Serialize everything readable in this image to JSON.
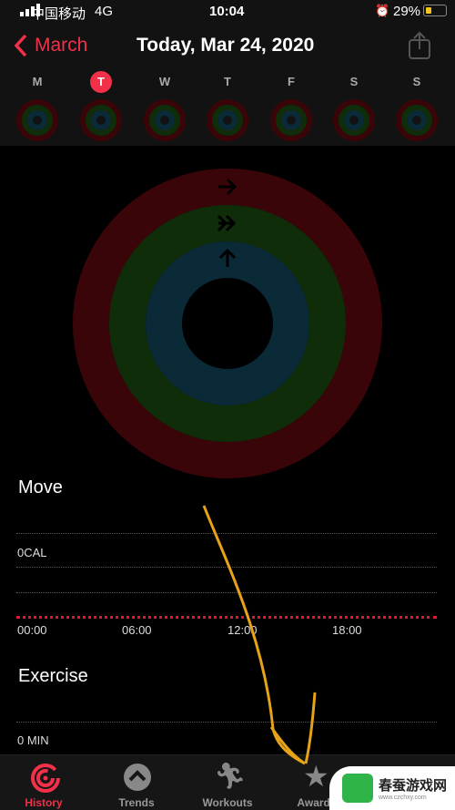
{
  "status": {
    "carrier": "中国移动",
    "network": "4G",
    "time": "10:04",
    "battery": "29%"
  },
  "header": {
    "back_label": "March",
    "title": "Today, Mar 24, 2020",
    "share_icon": "share-icon"
  },
  "week": {
    "days": [
      "M",
      "T",
      "W",
      "T",
      "F",
      "S",
      "S"
    ],
    "selected_index": 1
  },
  "colors": {
    "accent": "#f2304a",
    "move": "#e0182e",
    "exercise": "#3ad016",
    "stand": "#19c4e6",
    "annotation": "#e6a317"
  },
  "move": {
    "title": "Move",
    "value_label": "0CAL",
    "times": [
      "00:00",
      "06:00",
      "12:00",
      "18:00"
    ]
  },
  "exercise": {
    "title": "Exercise",
    "value_label": "0 MIN"
  },
  "tabs": [
    {
      "label": "History",
      "icon": "history-icon",
      "active": true
    },
    {
      "label": "Trends",
      "icon": "trends-icon"
    },
    {
      "label": "Workouts",
      "icon": "workouts-icon"
    },
    {
      "label": "Awards",
      "icon": "awards-icon"
    }
  ],
  "watermark": {
    "text": "春蚕游戏网",
    "url_text": "www.czchxy.com"
  }
}
